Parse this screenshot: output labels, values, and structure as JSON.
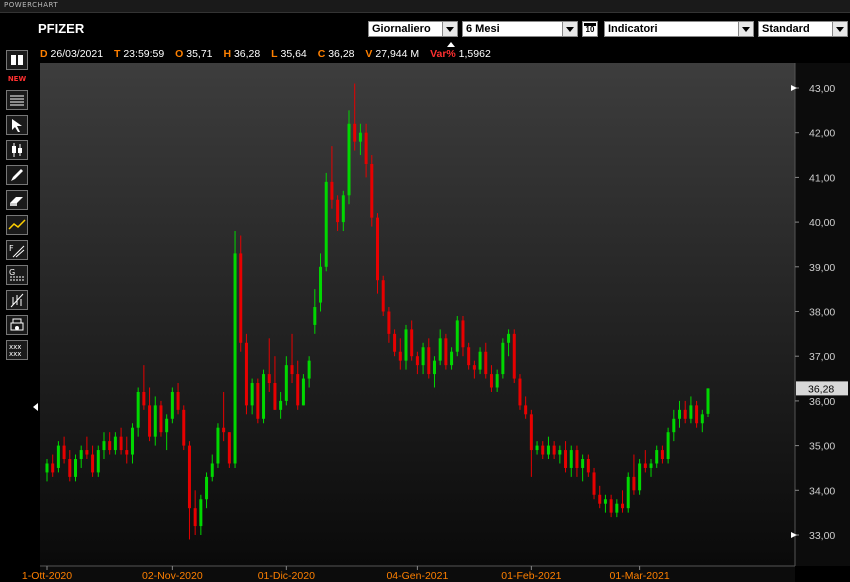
{
  "app": {
    "title": "POWERCHART"
  },
  "header": {
    "symbol": "PFIZER",
    "period_select": "Giornaliero",
    "range_select": "6 Mesi",
    "indicators_select": "Indicatori",
    "style_select": "Standard",
    "calendar_label": "10"
  },
  "infobar": {
    "d_label": "D",
    "d_value": "26/03/2021",
    "t_label": "T",
    "t_value": "23:59:59",
    "o_label": "O",
    "o_value": "35,71",
    "h_label": "H",
    "h_value": "36,28",
    "l_label": "L",
    "l_value": "35,64",
    "c_label": "C",
    "c_value": "36,28",
    "v_label": "V",
    "v_value": "27,944 M",
    "var_label": "Var%",
    "var_value": "1,5962"
  },
  "toolbar": {
    "new_label": "NEW",
    "tools": [
      "layout-icon",
      "new-badge",
      "list-settings-icon",
      "cursor-icon",
      "candle-type-icon",
      "pencil-icon",
      "eraser-icon",
      "trendline-icon",
      "fibonacci-icon",
      "levels-icon",
      "bar-tool-icon",
      "print-icon",
      "pattern-icon"
    ]
  },
  "colors": {
    "up": "#00d800",
    "down": "#e80000",
    "axis_text": "#cfcfcf",
    "price_box_bg": "#d8d8d8",
    "date_label": "#ff8000"
  },
  "chart_data": {
    "type": "candlestick",
    "title": "PFIZER",
    "ylim": [
      32.6,
      43.2
    ],
    "y_ticks": [
      "43,00",
      "42,00",
      "41,00",
      "40,00",
      "39,00",
      "38,00",
      "37,00",
      "36,00",
      "35,00",
      "34,00",
      "33,00"
    ],
    "y_tick_values": [
      43,
      42,
      41,
      40,
      39,
      38,
      37,
      36,
      35,
      34,
      33
    ],
    "x_tick_labels": [
      "1-Ott-2020",
      "02-Nov-2020",
      "01-Dic-2020",
      "04-Gen-2021",
      "01-Feb-2021",
      "01-Mar-2021"
    ],
    "x_tick_index": [
      0,
      22,
      42,
      65,
      85,
      104
    ],
    "last_price_label": "36,28",
    "last_price": 36.28,
    "grid": false,
    "candles": [
      [
        34.4,
        34.7,
        34.2,
        34.6
      ],
      [
        34.6,
        34.8,
        34.3,
        34.4
      ],
      [
        34.5,
        35.1,
        34.4,
        35.0
      ],
      [
        35.0,
        35.2,
        34.6,
        34.7
      ],
      [
        34.7,
        34.9,
        34.2,
        34.3
      ],
      [
        34.3,
        34.8,
        34.2,
        34.7
      ],
      [
        34.7,
        35.0,
        34.5,
        34.9
      ],
      [
        34.9,
        35.2,
        34.7,
        34.8
      ],
      [
        34.8,
        35.0,
        34.3,
        34.4
      ],
      [
        34.4,
        35.0,
        34.3,
        34.9
      ],
      [
        34.9,
        35.3,
        34.7,
        35.1
      ],
      [
        35.1,
        35.3,
        34.8,
        34.9
      ],
      [
        34.9,
        35.3,
        34.8,
        35.2
      ],
      [
        35.2,
        35.4,
        34.8,
        34.9
      ],
      [
        34.9,
        35.2,
        34.6,
        34.8
      ],
      [
        34.8,
        35.5,
        34.6,
        35.4
      ],
      [
        35.4,
        36.3,
        35.2,
        36.2
      ],
      [
        36.2,
        36.8,
        35.8,
        35.9
      ],
      [
        35.9,
        36.3,
        35.1,
        35.2
      ],
      [
        35.2,
        36.1,
        35.0,
        35.9
      ],
      [
        35.9,
        36.0,
        35.2,
        35.3
      ],
      [
        35.3,
        35.7,
        34.9,
        35.6
      ],
      [
        35.6,
        36.3,
        35.5,
        36.2
      ],
      [
        36.2,
        36.4,
        35.7,
        35.8
      ],
      [
        35.8,
        35.9,
        34.9,
        35.0
      ],
      [
        35.0,
        35.1,
        32.9,
        33.6
      ],
      [
        33.6,
        34.0,
        33.0,
        33.2
      ],
      [
        33.2,
        33.9,
        33.0,
        33.8
      ],
      [
        33.8,
        34.4,
        33.6,
        34.3
      ],
      [
        34.3,
        34.8,
        34.2,
        34.6
      ],
      [
        34.6,
        35.5,
        34.5,
        35.4
      ],
      [
        35.4,
        36.2,
        35.1,
        35.3
      ],
      [
        35.3,
        35.3,
        34.5,
        34.6
      ],
      [
        34.6,
        39.8,
        34.5,
        39.3
      ],
      [
        39.3,
        39.7,
        37.1,
        37.3
      ],
      [
        37.3,
        37.5,
        35.7,
        35.9
      ],
      [
        35.9,
        36.5,
        35.7,
        36.4
      ],
      [
        36.4,
        36.5,
        35.5,
        35.6
      ],
      [
        35.6,
        36.7,
        35.5,
        36.6
      ],
      [
        36.6,
        37.4,
        36.2,
        36.4
      ],
      [
        36.4,
        37.0,
        35.8,
        35.8
      ],
      [
        35.8,
        36.2,
        35.6,
        36.0
      ],
      [
        36.0,
        37.0,
        35.9,
        36.8
      ],
      [
        36.8,
        37.5,
        36.4,
        36.6
      ],
      [
        36.6,
        36.9,
        35.8,
        35.9
      ],
      [
        35.9,
        36.6,
        35.9,
        36.5
      ],
      [
        36.5,
        37.0,
        36.3,
        36.9
      ],
      [
        37.7,
        38.5,
        37.5,
        38.1
      ],
      [
        38.2,
        39.3,
        38.0,
        39.0
      ],
      [
        39.0,
        41.1,
        38.9,
        40.9
      ],
      [
        40.9,
        41.7,
        40.3,
        40.5
      ],
      [
        40.5,
        40.6,
        39.8,
        40.0
      ],
      [
        40.0,
        40.7,
        39.8,
        40.6
      ],
      [
        40.6,
        42.5,
        40.4,
        42.2
      ],
      [
        42.2,
        43.1,
        41.6,
        41.8
      ],
      [
        41.8,
        42.2,
        41.5,
        42.0
      ],
      [
        42.0,
        42.2,
        41.0,
        41.3
      ],
      [
        41.3,
        41.5,
        39.9,
        40.1
      ],
      [
        40.1,
        40.2,
        38.4,
        38.7
      ],
      [
        38.7,
        38.8,
        37.9,
        38.0
      ],
      [
        38.0,
        38.1,
        37.3,
        37.5
      ],
      [
        37.5,
        37.6,
        37.0,
        37.1
      ],
      [
        37.1,
        37.4,
        36.7,
        36.9
      ],
      [
        36.9,
        37.7,
        36.7,
        37.6
      ],
      [
        37.6,
        37.8,
        36.9,
        37.0
      ],
      [
        37.0,
        37.1,
        36.6,
        36.8
      ],
      [
        36.8,
        37.3,
        36.6,
        37.2
      ],
      [
        37.2,
        37.4,
        36.5,
        36.6
      ],
      [
        36.6,
        37.0,
        36.3,
        36.9
      ],
      [
        36.9,
        37.6,
        36.8,
        37.4
      ],
      [
        37.4,
        37.5,
        36.7,
        36.8
      ],
      [
        36.8,
        37.2,
        36.7,
        37.1
      ],
      [
        37.1,
        37.9,
        37.0,
        37.8
      ],
      [
        37.8,
        37.9,
        37.0,
        37.2
      ],
      [
        37.2,
        37.3,
        36.7,
        36.8
      ],
      [
        36.8,
        36.9,
        36.5,
        36.7
      ],
      [
        36.7,
        37.2,
        36.6,
        37.1
      ],
      [
        37.1,
        37.3,
        36.5,
        36.6
      ],
      [
        36.6,
        36.8,
        36.2,
        36.3
      ],
      [
        36.3,
        36.7,
        36.2,
        36.6
      ],
      [
        36.6,
        37.4,
        36.5,
        37.3
      ],
      [
        37.3,
        37.6,
        37.0,
        37.5
      ],
      [
        37.5,
        37.6,
        36.4,
        36.5
      ],
      [
        36.5,
        36.6,
        35.8,
        35.9
      ],
      [
        35.9,
        36.1,
        35.6,
        35.7
      ],
      [
        35.7,
        35.8,
        34.3,
        34.9
      ],
      [
        34.9,
        35.1,
        34.8,
        35.0
      ],
      [
        35.0,
        35.1,
        34.7,
        34.8
      ],
      [
        34.8,
        35.2,
        34.7,
        35.0
      ],
      [
        35.0,
        35.1,
        34.7,
        34.8
      ],
      [
        34.8,
        35.0,
        34.6,
        34.9
      ],
      [
        34.9,
        35.1,
        34.4,
        34.5
      ],
      [
        34.5,
        35.0,
        34.3,
        34.9
      ],
      [
        34.9,
        35.0,
        34.3,
        34.5
      ],
      [
        34.5,
        34.8,
        34.2,
        34.7
      ],
      [
        34.7,
        34.8,
        34.3,
        34.4
      ],
      [
        34.4,
        34.5,
        33.8,
        33.9
      ],
      [
        33.9,
        34.1,
        33.6,
        33.7
      ],
      [
        33.7,
        33.9,
        33.5,
        33.8
      ],
      [
        33.8,
        33.9,
        33.4,
        33.5
      ],
      [
        33.5,
        33.8,
        33.4,
        33.7
      ],
      [
        33.7,
        34.0,
        33.5,
        33.6
      ],
      [
        33.6,
        34.4,
        33.5,
        34.3
      ],
      [
        34.3,
        34.8,
        33.9,
        34.0
      ],
      [
        34.0,
        34.7,
        33.9,
        34.6
      ],
      [
        34.6,
        34.9,
        34.4,
        34.5
      ],
      [
        34.5,
        34.7,
        34.3,
        34.6
      ],
      [
        34.6,
        35.0,
        34.5,
        34.9
      ],
      [
        34.9,
        35.0,
        34.6,
        34.7
      ],
      [
        34.7,
        35.4,
        34.6,
        35.3
      ],
      [
        35.3,
        35.8,
        35.1,
        35.6
      ],
      [
        35.6,
        36.0,
        35.4,
        35.8
      ],
      [
        35.8,
        36.0,
        35.5,
        35.6
      ],
      [
        35.6,
        36.1,
        35.5,
        35.9
      ],
      [
        35.9,
        36.0,
        35.4,
        35.5
      ],
      [
        35.5,
        35.8,
        35.3,
        35.7
      ],
      [
        35.71,
        36.28,
        35.64,
        36.28
      ]
    ]
  }
}
